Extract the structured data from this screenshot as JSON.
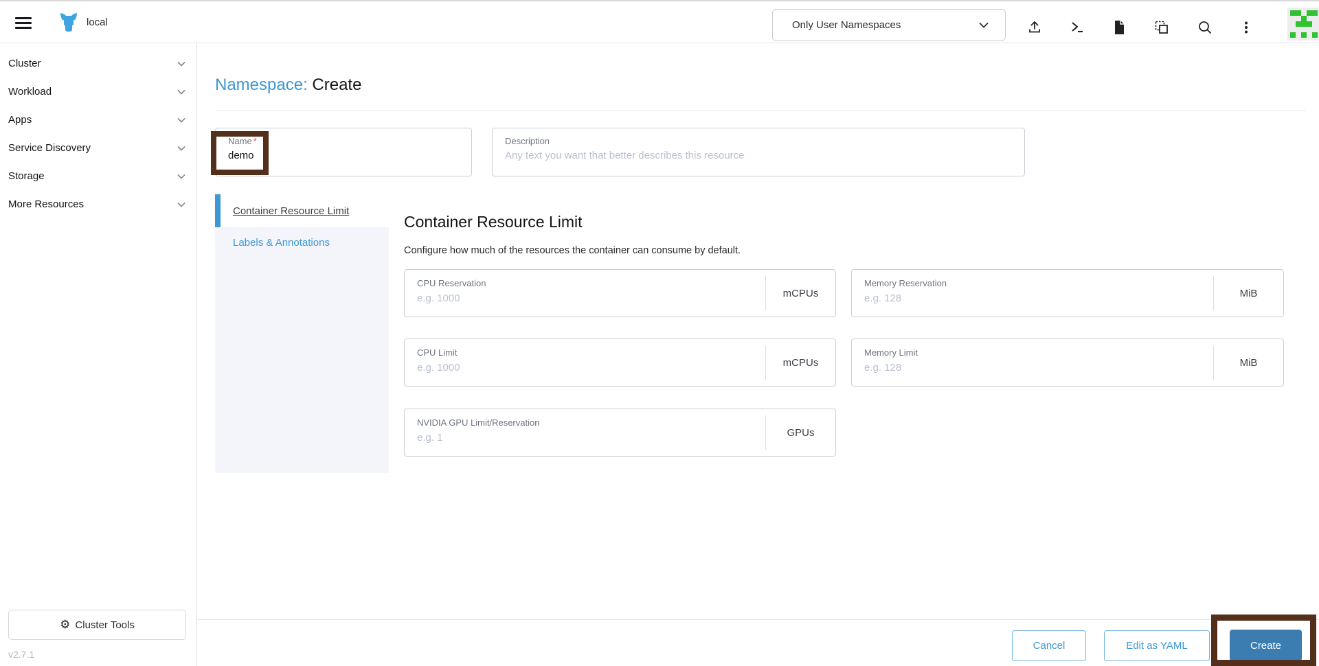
{
  "header": {
    "cluster_name": "local",
    "namespace_filter": {
      "value": "Only User Namespaces"
    },
    "icons": [
      "hamburger-menu",
      "rancher-logo",
      "namespace-filter-chevron",
      "import-yaml",
      "kubectl-shell",
      "copy-kubeconfig",
      "download-kubeconfig",
      "search",
      "kebab-menu",
      "user-avatar"
    ]
  },
  "sidebar": {
    "items": [
      {
        "label": "Cluster"
      },
      {
        "label": "Workload"
      },
      {
        "label": "Apps"
      },
      {
        "label": "Service Discovery"
      },
      {
        "label": "Storage"
      },
      {
        "label": "More Resources"
      }
    ],
    "cluster_tools_label": "Cluster Tools",
    "version": "v2.7.1"
  },
  "page": {
    "title_prefix": "Namespace:",
    "title_action": "Create",
    "name_field": {
      "label": "Name",
      "required_mark": "*",
      "value": "demo"
    },
    "description_field": {
      "label": "Description",
      "placeholder": "Any text you want that better describes this resource"
    },
    "tabs": [
      {
        "label": "Container Resource Limit",
        "active": true
      },
      {
        "label": "Labels & Annotations",
        "active": false
      }
    ],
    "section": {
      "heading": "Container Resource Limit",
      "description": "Configure how much of the resources the container can consume by default.",
      "fields": [
        {
          "label": "CPU Reservation",
          "placeholder": "e.g. 1000",
          "unit": "mCPUs"
        },
        {
          "label": "Memory Reservation",
          "placeholder": "e.g. 128",
          "unit": "MiB"
        },
        {
          "label": "CPU Limit",
          "placeholder": "e.g. 1000",
          "unit": "mCPUs"
        },
        {
          "label": "Memory Limit",
          "placeholder": "e.g. 128",
          "unit": "MiB"
        },
        {
          "label": "NVIDIA GPU Limit/Reservation",
          "placeholder": "e.g. 1",
          "unit": "GPUs"
        }
      ]
    },
    "footer": {
      "cancel_label": "Cancel",
      "edit_yaml_label": "Edit as YAML",
      "create_label": "Create"
    }
  },
  "colors": {
    "accent_blue": "#3d98d3",
    "primary_button_blue": "#3c7db1",
    "annotation_brown": "#54301c",
    "avatar_green": "#2fc32f",
    "tab_rail_bg": "#f4f5fa"
  }
}
